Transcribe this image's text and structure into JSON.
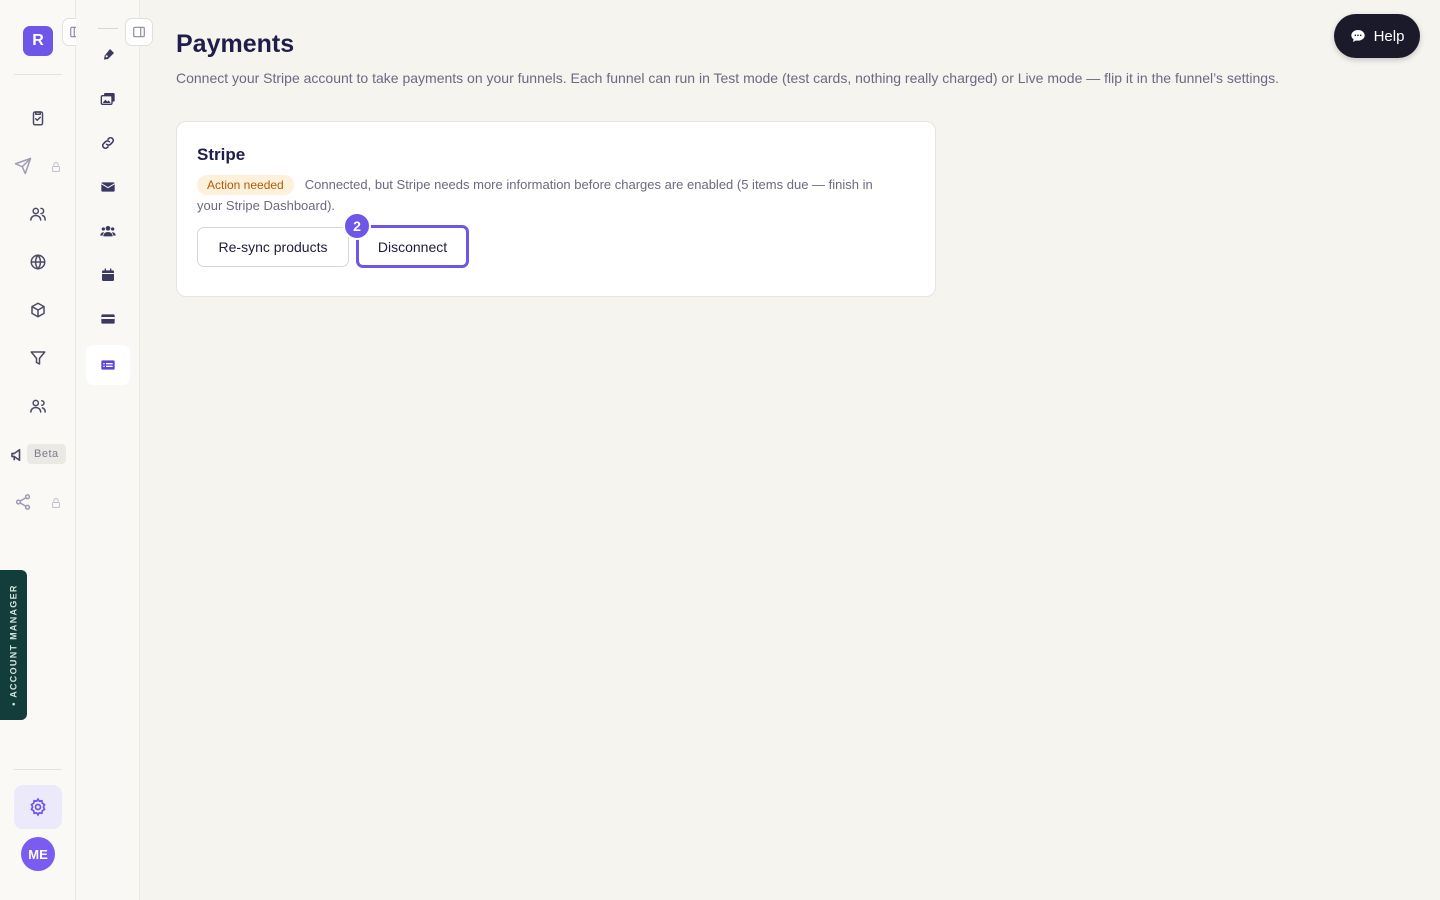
{
  "rail": {
    "logo_letter": "R",
    "beta_label": "Beta",
    "account_manager_label": "• ACCOUNT MANAGER",
    "avatar_initials": "ME"
  },
  "page": {
    "title": "Payments",
    "description": "Connect your Stripe account to take payments on your funnels. Each funnel can run in Test mode (test cards, nothing really charged) or Live mode — flip it in the funnel’s settings."
  },
  "stripe_card": {
    "title": "Stripe",
    "status_badge": "Action needed",
    "status_text": "Connected, but Stripe needs more information before charges are enabled (5 items due — finish in your Stripe Dashboard).",
    "resync_label": "Re-sync products",
    "disconnect_label": "Disconnect",
    "step_number": "2"
  },
  "help": {
    "label": "Help"
  },
  "colors": {
    "accent": "#6e56e8",
    "badge_bg": "#fdf1dc",
    "badge_text": "#b45a08",
    "account_tab": "#123d3a"
  }
}
